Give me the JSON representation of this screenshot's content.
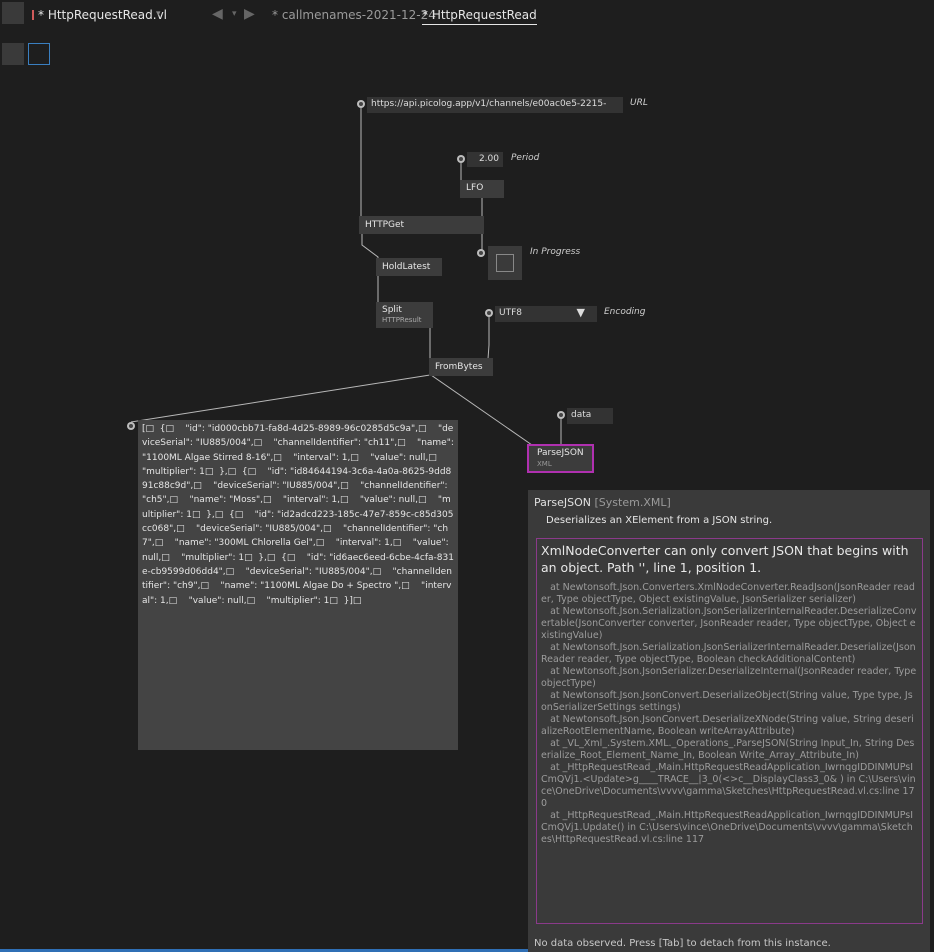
{
  "toolbar": {
    "file_tab": "* HttpRequestRead.vl",
    "dropdown_arrow": "▾",
    "nav_back": "◀",
    "nav_dropdown": "▾",
    "nav_forward": "▶",
    "doc_tabs": [
      {
        "label": "* callmenames-2021-12-24"
      },
      {
        "label": "* HttpRequestRead"
      }
    ]
  },
  "patch": {
    "url_value": "https://api.picolog.app/v1/channels/e00ac0e5-2215-",
    "url_label": "URL",
    "period_value": "2.00",
    "period_label": "Period",
    "lfo_label": "LFO",
    "httpget_label": "HTTPGet",
    "inprogress_label": "In Progress",
    "holdlatest_label": "HoldLatest",
    "split_label": "Split",
    "split_sublabel": "HTTPResult",
    "encoding_value": "UTF8",
    "encoding_arrow": "▼",
    "encoding_label": "Encoding",
    "frombytes_label": "FromBytes",
    "data_value": "data",
    "parsejson_label": "ParseJSON",
    "parsejson_sublabel": "XML",
    "json_output": "[□  {□    \"id\": \"id000cbb71-fa8d-4d25-8989-96c0285d5c9a\",□    \"deviceSerial\": \"IU885/004\",□    \"channelIdentifier\": \"ch11\",□    \"name\": \"1100ML Algae Stirred 8-16\",□    \"interval\": 1,□    \"value\": null,□    \"multiplier\": 1□  },□  {□    \"id\": \"id84644194-3c6a-4a0a-8625-9dd891c88c9d\",□    \"deviceSerial\": \"IU885/004\",□    \"channelIdentifier\": \"ch5\",□    \"name\": \"Moss\",□    \"interval\": 1,□    \"value\": null,□    \"multiplier\": 1□  },□  {□    \"id\": \"id2adcd223-185c-47e7-859c-c85d305cc068\",□    \"deviceSerial\": \"IU885/004\",□    \"channelIdentifier\": \"ch7\",□    \"name\": \"300ML Chlorella Gel\",□    \"interval\": 1,□    \"value\": null,□    \"multiplier\": 1□  },□  {□    \"id\": \"id6aec6eed-6cbe-4cfa-831e-cb9599d06dd4\",□    \"deviceSerial\": \"IU885/004\",□    \"channelIdentifier\": \"ch9\",□    \"name\": \"1100ML Algae Do + Spectro \",□    \"interval\": 1,□    \"value\": null,□    \"multiplier\": 1□  }]□"
  },
  "tooltip": {
    "node_name": "ParseJSON",
    "node_type": "[System.XML]",
    "description": "Deserializes an XElement from a JSON string.",
    "error_message": "XmlNodeConverter can only convert JSON that begins with an object. Path '', line 1, position 1.",
    "stack_trace": "   at Newtonsoft.Json.Converters.XmlNodeConverter.ReadJson(JsonReader reader, Type objectType, Object existingValue, JsonSerializer serializer)\n   at Newtonsoft.Json.Serialization.JsonSerializerInternalReader.DeserializeConvertable(JsonConverter converter, JsonReader reader, Type objectType, Object existingValue)\n   at Newtonsoft.Json.Serialization.JsonSerializerInternalReader.Deserialize(JsonReader reader, Type objectType, Boolean checkAdditionalContent)\n   at Newtonsoft.Json.JsonSerializer.DeserializeInternal(JsonReader reader, Type objectType)\n   at Newtonsoft.Json.JsonConvert.DeserializeObject(String value, Type type, JsonSerializerSettings settings)\n   at Newtonsoft.Json.JsonConvert.DeserializeXNode(String value, String deserializeRootElementName, Boolean writeArrayAttribute)\n   at _VL_Xml_.System.XML._Operations_.ParseJSON(String Input_In, String Deserialize_Root_Element_Name_In, Boolean Write_Array_Attribute_In)\n   at _HttpRequestRead_.Main.HttpRequestReadApplication_IwrnqgIDDINMUPsICmQVj1.<Update>g____TRACE__|3_0(<>c__DisplayClass3_0& ) in C:\\Users\\vince\\OneDrive\\Documents\\vvvv\\gamma\\Sketches\\HttpRequestRead.vl.cs:line 170\n   at _HttpRequestRead_.Main.HttpRequestReadApplication_IwrnqgIDDINMUPsICmQVj1.Update() in C:\\Users\\vince\\OneDrive\\Documents\\vvvv\\gamma\\Sketches\\HttpRequestRead.vl.cs:line 117",
    "footer": "No data observed. Press [Tab] to detach from this instance."
  }
}
